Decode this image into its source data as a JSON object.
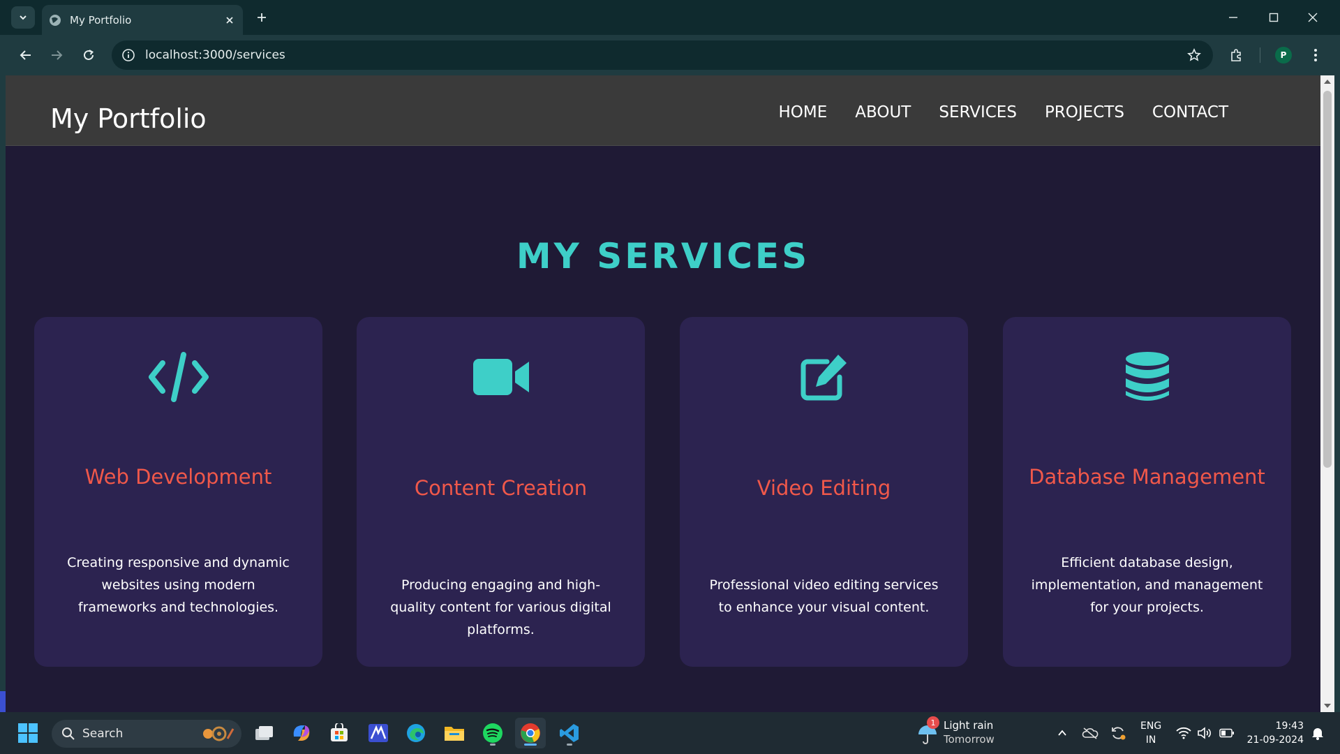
{
  "browser": {
    "tab_title": "My Portfolio",
    "url": "localhost:3000/services",
    "profile_initial": "P"
  },
  "site": {
    "logo": "My Portfolio",
    "nav": [
      "HOME",
      "ABOUT",
      "SERVICES",
      "PROJECTS",
      "CONTACT"
    ],
    "heading": "MY SERVICES",
    "accent_color": "#3ecfc8",
    "title_color": "#f0584a"
  },
  "services": [
    {
      "icon": "code-icon",
      "title": "Web Development",
      "description": "Creating responsive and dynamic websites using modern frameworks and technologies."
    },
    {
      "icon": "video-camera-icon",
      "title": "Content Creation",
      "description": "Producing engaging and high-quality content for various digital platforms."
    },
    {
      "icon": "edit-icon",
      "title": "Video Editing",
      "description": "Professional video editing services to enhance your visual content."
    },
    {
      "icon": "database-icon",
      "title": "Database Management",
      "description": "Efficient database design, implementation, and management for your projects."
    }
  ],
  "taskbar": {
    "search_label": "Search",
    "weather_title": "Light rain",
    "weather_sub": "Tomorrow",
    "weather_badge": "1",
    "lang_top": "ENG",
    "lang_bottom": "IN",
    "time": "19:43",
    "date": "21-09-2024"
  }
}
